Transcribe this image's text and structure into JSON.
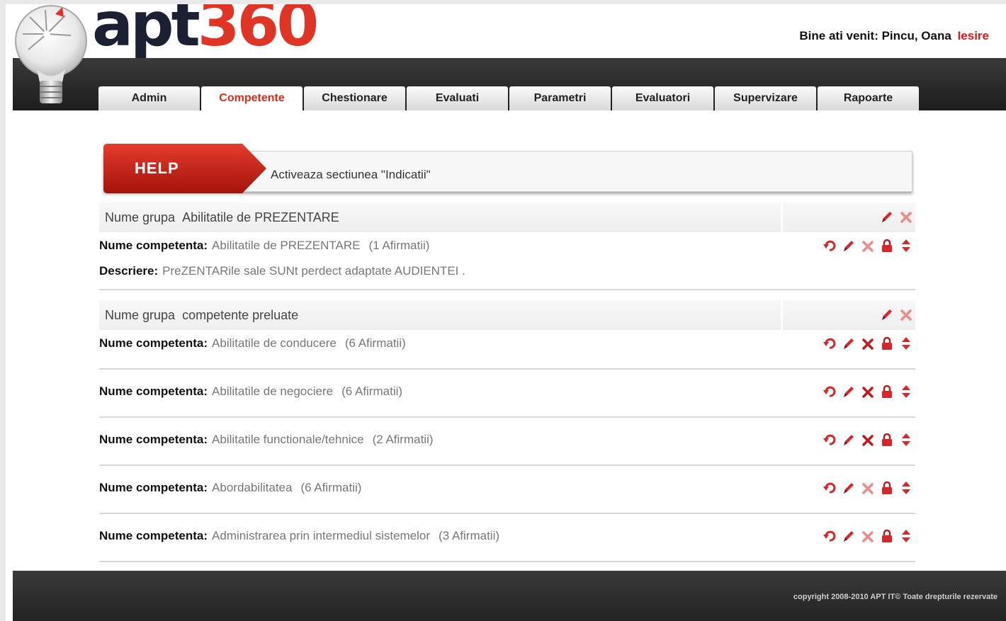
{
  "header": {
    "logo_left": "apt",
    "logo_right": "360",
    "welcome": "Bine ati venit: Pincu, Oana",
    "logout": "Iesire"
  },
  "tabs": [
    {
      "label": "Admin"
    },
    {
      "label": "Competente"
    },
    {
      "label": "Chestionare"
    },
    {
      "label": "Evaluati"
    },
    {
      "label": "Parametri"
    },
    {
      "label": "Evaluatori"
    },
    {
      "label": "Supervizare"
    },
    {
      "label": "Rapoarte"
    }
  ],
  "active_tab": "Competente",
  "help": {
    "tag": "HELP",
    "message": "Activeaza sectiunea \"Indicatii\""
  },
  "labels": {
    "group": "Nume grupa",
    "competency": "Nume competenta:",
    "description": "Descriere:"
  },
  "groups": [
    {
      "name": "Abilitatile de PREZENTARE",
      "competencies": [
        {
          "name": "Abilitatile de PREZENTARE",
          "count": "(1 Afirmatii)",
          "description": "PreZENTARile sale SUNt perdect adaptate AUDIENTEI ."
        }
      ]
    },
    {
      "name": "competente preluate",
      "competencies": [
        {
          "name": "Abilitatile de conducere",
          "count": "(6 Afirmatii)"
        },
        {
          "name": "Abilitatile de negociere",
          "count": "(6 Afirmatii)"
        },
        {
          "name": "Abilitatile functionale/tehnice",
          "count": "(2 Afirmatii)"
        },
        {
          "name": "Abordabilitatea",
          "count": "(6 Afirmatii)"
        },
        {
          "name": "Administrarea prin intermediul sistemelor",
          "count": "(3 Afirmatii)"
        }
      ]
    }
  ],
  "footer": {
    "copyright": "copyright 2008-2010 APT IT© Toate drepturile rezervate"
  },
  "colors": {
    "accent": "#e02b1b",
    "dark_bar": "#232323",
    "logo_dark": "#1b2033"
  },
  "icons": {
    "undo": "undo-icon",
    "edit": "pencil-icon",
    "delete": "delete-icon",
    "lock": "lock-icon",
    "move": "reorder-icon"
  }
}
